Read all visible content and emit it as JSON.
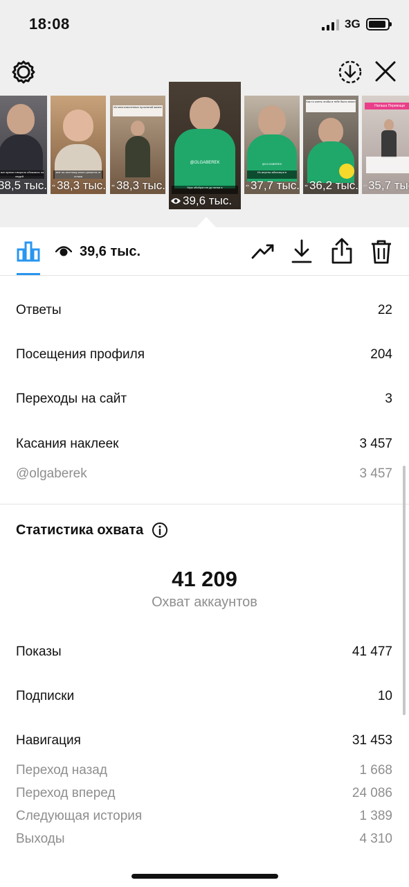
{
  "status_bar": {
    "time": "18:08",
    "network": "3G",
    "signal_bars_on": 3,
    "signal_bars_total": 4,
    "battery_level": 0.8
  },
  "header": {
    "settings_icon": "gear-icon",
    "download_icon": "download-circle-icon",
    "close_icon": "close-icon"
  },
  "thumbnails": [
    {
      "views": "38,5 тыс.",
      "caption": "мне все время говорили обижаюсь на людей",
      "active": false
    },
    {
      "views": "38,3 тыс.",
      "caption": "мне по-честному много ремонта от сглаза",
      "active": false
    },
    {
      "views": "38,3 тыс.",
      "caption": "Из многочисленных проклятий жизни",
      "active": false
    },
    {
      "views": "39,6 тыс.",
      "caption": "Муж обобрал ее до нитки и",
      "watermark": "@OLGABEREK",
      "active": true
    },
    {
      "views": "37,7 тыс.",
      "caption": "Из жертвы абьюзера в",
      "watermark": "@OLGABEREK",
      "active": false
    },
    {
      "views": "36,2 тыс.",
      "caption": "Как то очень чтобы в тебе было много",
      "active": false
    },
    {
      "views": "35,7 тыс.",
      "caption": "Наташа Перевощи",
      "active": false
    }
  ],
  "toolbar": {
    "views": "39,6 тыс.",
    "insights_icon": "bar-chart-icon",
    "eye_icon": "eye-icon",
    "promote_icon": "trending-icon",
    "save_icon": "download-icon",
    "share_icon": "share-icon",
    "delete_icon": "trash-icon"
  },
  "interactions": [
    {
      "label": "Ответы",
      "value": "22"
    },
    {
      "label": "Посещения профиля",
      "value": "204"
    },
    {
      "label": "Переходы на сайт",
      "value": "3"
    },
    {
      "label": "Касания наклеек",
      "value": "3 457"
    }
  ],
  "sticker_detail": {
    "label": "@olgaberek",
    "value": "3 457"
  },
  "reach": {
    "title": "Статистика охвата",
    "number": "41 209",
    "label": "Охват аккаунтов"
  },
  "reach_stats": [
    {
      "label": "Показы",
      "value": "41 477"
    },
    {
      "label": "Подписки",
      "value": "10"
    },
    {
      "label": "Навигация",
      "value": "31 453"
    }
  ],
  "navigation_detail": [
    {
      "label": "Переход назад",
      "value": "1 668"
    },
    {
      "label": "Переход вперед",
      "value": "24 086"
    },
    {
      "label": "Следующая история",
      "value": "1 389"
    },
    {
      "label": "Выходы",
      "value": "4 310"
    }
  ],
  "colors": {
    "accent": "#2996f0",
    "muted": "#8e8e8e",
    "top_background": "#efefef"
  }
}
